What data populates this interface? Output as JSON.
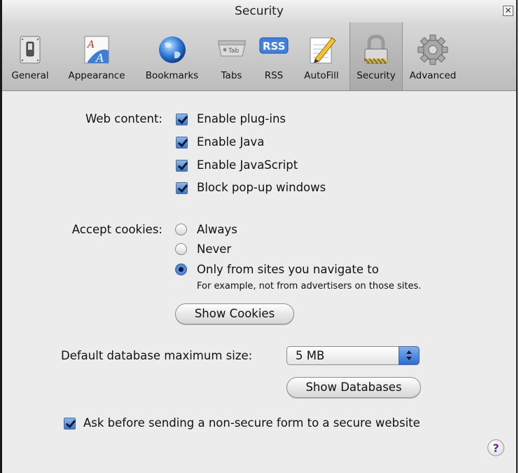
{
  "window": {
    "title": "Security",
    "close_glyph": "✕"
  },
  "toolbar": {
    "items": [
      {
        "label": "General",
        "icon": "switch-icon"
      },
      {
        "label": "Appearance",
        "icon": "fonts-icon"
      },
      {
        "label": "Bookmarks",
        "icon": "globe-icon"
      },
      {
        "label": "Tabs",
        "icon": "tab-icon",
        "icon_text": "Tab"
      },
      {
        "label": "RSS",
        "icon": "rss-icon",
        "icon_text": "RSS"
      },
      {
        "label": "AutoFill",
        "icon": "pencil-icon"
      },
      {
        "label": "Security",
        "icon": "lock-icon",
        "selected": true
      },
      {
        "label": "Advanced",
        "icon": "gear-icon"
      }
    ]
  },
  "web_content": {
    "label": "Web content:",
    "options": [
      {
        "label": "Enable plug-ins",
        "checked": true
      },
      {
        "label": "Enable Java",
        "checked": true
      },
      {
        "label": "Enable JavaScript",
        "checked": true
      },
      {
        "label": "Block pop-up windows",
        "checked": true
      }
    ]
  },
  "cookies": {
    "label": "Accept cookies:",
    "options": [
      {
        "label": "Always",
        "selected": false
      },
      {
        "label": "Never",
        "selected": false
      },
      {
        "label": "Only from sites you navigate to",
        "selected": true
      }
    ],
    "note": "For example, not from advertisers on those sites.",
    "show_button": "Show Cookies"
  },
  "database": {
    "label": "Default database maximum size:",
    "value": "5 MB",
    "show_button": "Show Databases"
  },
  "nonsecure_form": {
    "label": "Ask before sending a non-secure form to a secure website",
    "checked": true
  },
  "help": {
    "glyph": "?"
  },
  "colors": {
    "accent": "#3a78d0",
    "toolbar": "#c9c9c9",
    "pane": "#ececec"
  }
}
